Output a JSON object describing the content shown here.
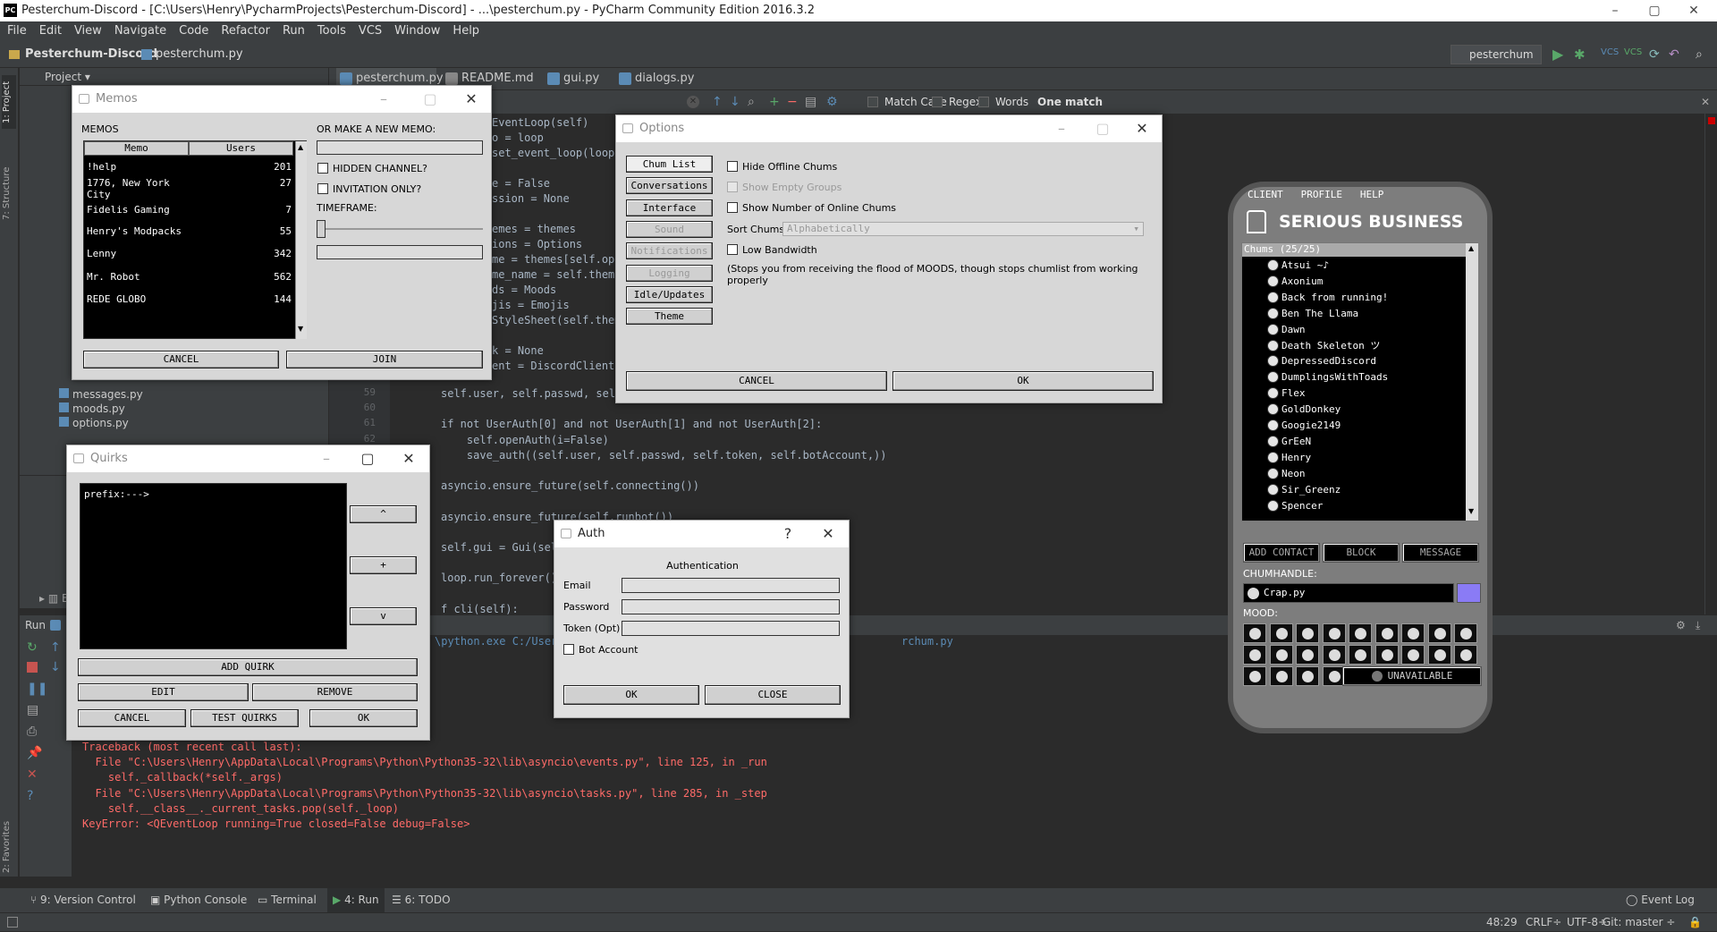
{
  "window": {
    "title": "Pesterchum-Discord - [C:\\Users\\Henry\\PycharmProjects\\Pesterchum-Discord] - ...\\pesterchum.py - PyCharm Community Edition 2016.3.2",
    "min": "–",
    "max": "▢",
    "close": "✕"
  },
  "menu": [
    "File",
    "Edit",
    "View",
    "Navigate",
    "Code",
    "Refactor",
    "Run",
    "Tools",
    "VCS",
    "Window",
    "Help"
  ],
  "nav": {
    "project": "Pesterchum-Discord",
    "file": "pesterchum.py",
    "run_config": "pesterchum"
  },
  "side_labels": {
    "project": "1: Project",
    "structure": "7: Structure",
    "favorites": "2: Favorites"
  },
  "project_panel": {
    "title": "Project",
    "files": [
      "messages.py",
      "moods.py",
      "options.py"
    ],
    "ext_label": "Ex"
  },
  "tabs": [
    "pesterchum.py",
    "README.md",
    "gui.py",
    "dialogs.py"
  ],
  "find": {
    "match_case": "Match Case",
    "regex": "Regex",
    "words": "Words",
    "result": "One match"
  },
  "code_top": [
    "EventLoop(self)",
    "o = loop",
    "set_event_loop(loop)",
    "",
    "e = False",
    "ssion = None",
    "",
    "emes = themes",
    "ions = Options",
    "me = themes[self.opt",
    "me_name = self.theme",
    "ds = Moods",
    "jis = Emojis",
    "StyleSheet(self.them",
    "",
    "k = None",
    "ent = DiscordClient("
  ],
  "code_lines": [
    {
      "n": "59",
      "t": "self.user, self.passwd, self"
    },
    {
      "n": "60",
      "t": ""
    },
    {
      "n": "61",
      "t": "if not UserAuth[0] and not UserAuth[1] and not UserAuth[2]:"
    },
    {
      "n": "62",
      "t": "    self.openAuth(i=False)"
    },
    {
      "n": "63",
      "t": "    save_auth((self.user, self.passwd, self.token, self.botAccount,))"
    },
    {
      "n": "64",
      "t": ""
    },
    {
      "n": "65",
      "t": "asyncio.ensure_future(self.connecting())"
    },
    {
      "n": "66",
      "t": ""
    },
    {
      "n": "67",
      "t": "asyncio.ensure_future(self.runbot())"
    },
    {
      "n": "68",
      "t": ""
    },
    {
      "n": "69",
      "t": "self.gui = Gui(self"
    },
    {
      "n": "70",
      "t": ""
    },
    {
      "n": "71",
      "t": "loop.run_forever()"
    },
    {
      "n": "72",
      "t": ""
    },
    {
      "n": "73",
      "t": "f cli(self):"
    }
  ],
  "run": {
    "label": "Run",
    "cmd": "\\python.exe C:/User",
    "cmd_tail": "rchum.py"
  },
  "console": [
    "Traceback (most recent call last):",
    "  File \"C:\\Users\\Henry\\AppData\\Local\\Programs\\Python\\Python35-32\\lib\\asyncio\\events.py\", line 125, in _run",
    "    self._callback(*self._args)",
    "  File \"C:\\Users\\Henry\\AppData\\Local\\Programs\\Python\\Python35-32\\lib\\asyncio\\tasks.py\", line 285, in _step",
    "    self.__class__._current_tasks.pop(self._loop)",
    "KeyError: <QEventLoop running=True closed=False debug=False>"
  ],
  "bottom_tabs": [
    "9: Version Control",
    "Python Console",
    "Terminal",
    "4: Run",
    "6: TODO"
  ],
  "event_log": "Event Log",
  "status": {
    "pos": "48:29",
    "crlf": "CRLF÷",
    "enc": "UTF-8÷",
    "git": "Git: master ÷"
  },
  "memos": {
    "title": "Memos",
    "heading": "MEMOS",
    "col_memo": "Memo",
    "col_users": "Users",
    "new_memo": "OR MAKE A NEW MEMO:",
    "hidden": "HIDDEN CHANNEL?",
    "invite": "INVITATION ONLY?",
    "timeframe": "TIMEFRAME:",
    "cancel": "CANCEL",
    "join": "JOIN",
    "rows": [
      {
        "name": "!help",
        "users": "201"
      },
      {
        "name": "1776, New York City",
        "users": "27"
      },
      {
        "name": "Fidelis Gaming",
        "users": "7"
      },
      {
        "name": "Henry's Modpacks",
        "users": "55"
      },
      {
        "name": "Lenny",
        "users": "342"
      },
      {
        "name": "Mr. Robot",
        "users": "562"
      },
      {
        "name": "REDE GLOBO",
        "users": "144"
      }
    ]
  },
  "quirks": {
    "title": "Quirks",
    "text": "prefix:--->",
    "up": "^",
    "plus": "+",
    "down": "v",
    "add": "ADD QUIRK",
    "edit": "EDIT",
    "remove": "REMOVE",
    "cancel": "CANCEL",
    "test": "TEST QUIRKS",
    "ok": "OK"
  },
  "options": {
    "title": "Options",
    "tabs": [
      "Chum List",
      "Conversations",
      "Interface",
      "Sound",
      "Notifications",
      "Logging",
      "Idle/Updates",
      "Theme"
    ],
    "hide_offline": "Hide Offline Chums",
    "show_empty": "Show Empty Groups",
    "show_number": "Show Number of Online Chums",
    "sort_label": "Sort Chums",
    "sort_value": "Alphabetically",
    "low_bw": "Low Bandwidth",
    "low_bw_note": "(Stops you from receiving the flood of MOODS, though stops chumlist from working properly",
    "cancel": "CANCEL",
    "ok": "OK"
  },
  "auth": {
    "title": "Auth",
    "help": "?",
    "close_x": "✕",
    "heading": "Authentication",
    "email": "Email",
    "password": "Password",
    "token": "Token (Opt)",
    "bot": "Bot Account",
    "ok": "OK",
    "close": "CLOSE"
  },
  "chumlist": {
    "menu": [
      "CLIENT",
      "PROFILE",
      "HELP"
    ],
    "banner": "SERIOUS BUSINESS",
    "header": "Chums (25/25)",
    "chums": [
      "Atsui ~♪",
      "Axonium",
      "Back from running!",
      "Ben The Llama",
      "Dawn",
      "Death Skeleton ツ",
      "DepressedDiscord",
      "DumplingsWithToads",
      "Flex",
      "GoldDonkey",
      "Googie2149",
      "GrEeN",
      "Henry",
      "Neon",
      "Sir_Greenz",
      "Spencer"
    ],
    "add": "ADD CONTACT",
    "block": "BLOCK",
    "message": "MESSAGE",
    "handle_label": "CHUMHANDLE:",
    "handle": "Crap.py",
    "mood_label": "MOOD:",
    "unavailable": "UNAVAILABLE",
    "accent": "#8a7bf5"
  }
}
